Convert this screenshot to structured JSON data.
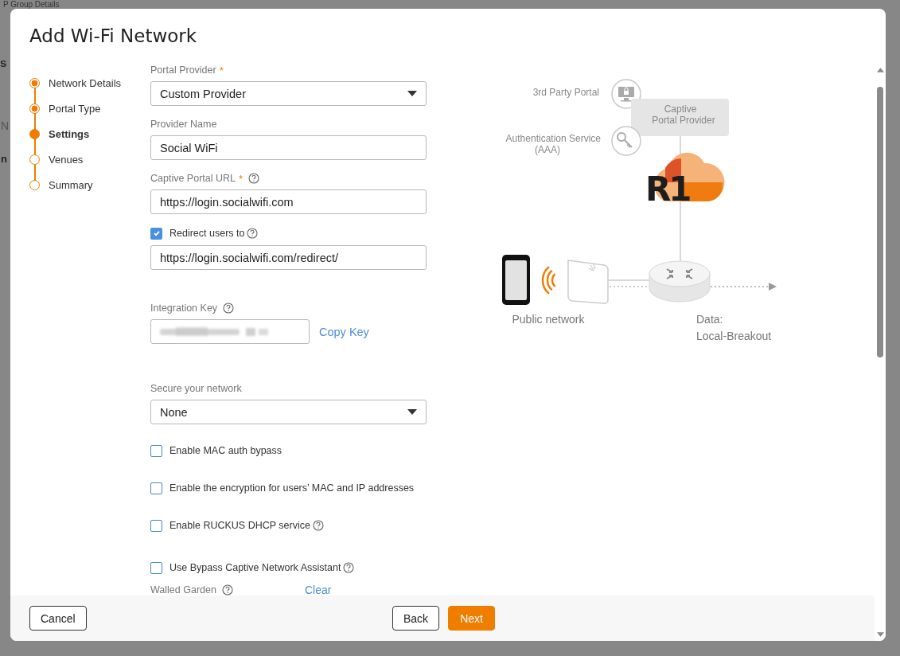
{
  "backdrop": {
    "fragments": [
      {
        "kind": "heading",
        "text": "P Group Details"
      },
      {
        "kind": "tab",
        "text": "s"
      },
      {
        "kind": "field",
        "text": "N"
      },
      {
        "kind": "row",
        "text": "n"
      }
    ]
  },
  "dialog": {
    "title": "Add Wi-Fi Network"
  },
  "steps": [
    {
      "label": "Network Details",
      "completed": true,
      "selected": false
    },
    {
      "label": "Portal Type",
      "completed": true,
      "selected": false
    },
    {
      "label": "Settings",
      "selected": true
    },
    {
      "label": "Venues",
      "completed": false,
      "selected": false
    },
    {
      "label": "Summary",
      "completed": false,
      "selected": false
    }
  ],
  "form": {
    "required_mark": "*",
    "fields": [
      {
        "kind": "select",
        "label": "Portal Provider",
        "required": true,
        "value": "Custom Provider"
      },
      {
        "kind": "input",
        "label": "Provider Name",
        "value": "Social WiFi"
      },
      {
        "kind": "input",
        "label": "Captive Portal URL",
        "required": true,
        "help": true,
        "value": "https://login.socialwifi.com"
      },
      {
        "kind": "checked-input",
        "label": "Redirect users to",
        "checked": true,
        "help": true,
        "value": "https://login.socialwifi.com/redirect/"
      },
      {
        "kind": "key",
        "label": "Integration Key",
        "help": true,
        "action": "Copy Key"
      },
      {
        "kind": "select",
        "label": "Secure your network",
        "value": "None"
      },
      {
        "kind": "checkbox",
        "label": "Enable MAC auth bypass",
        "checked": false
      },
      {
        "kind": "checkbox",
        "label": "Enable the encryption for users’ MAC and IP addresses",
        "checked": false
      },
      {
        "kind": "checkbox",
        "label": "Enable RUCKUS DHCP service",
        "checked": false,
        "help": true
      },
      {
        "kind": "checkbox",
        "label": "Use Bypass Captive Network Assistant",
        "checked": false,
        "help": true
      },
      {
        "kind": "link-row",
        "label": "Walled Garden",
        "help": true,
        "action": "Clear"
      }
    ]
  },
  "diagram": {
    "portal_label": "3rd Party Portal",
    "auth_label": [
      "Authentication Service",
      "(AAA)"
    ],
    "provider_box": [
      "Captive",
      "Portal Provider"
    ],
    "logo_text": "R1",
    "public_label": "Public network",
    "data_label": [
      "Data:",
      "Local-Breakout"
    ]
  },
  "footer": {
    "cancel": "Cancel",
    "back": "Back",
    "next": "Next"
  }
}
